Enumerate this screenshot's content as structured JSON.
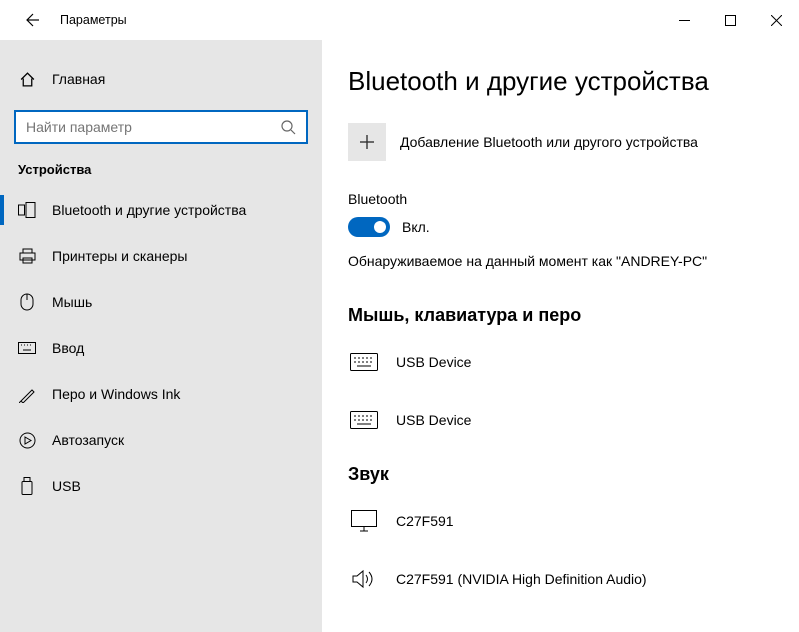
{
  "titlebar": {
    "title": "Параметры"
  },
  "sidebar": {
    "home_label": "Главная",
    "search_placeholder": "Найти параметр",
    "section_title": "Устройства",
    "items": [
      {
        "label": "Bluetooth и другие устройства"
      },
      {
        "label": "Принтеры и сканеры"
      },
      {
        "label": "Мышь"
      },
      {
        "label": "Ввод"
      },
      {
        "label": "Перо и Windows Ink"
      },
      {
        "label": "Автозапуск"
      },
      {
        "label": "USB"
      }
    ]
  },
  "main": {
    "title": "Bluetooth и другие устройства",
    "add_label": "Добавление Bluetooth или другого устройства",
    "bt_label": "Bluetooth",
    "bt_toggle_state": "Вкл.",
    "discover_text": "Обнаруживаемое на данный момент как \"ANDREY-PC\"",
    "group1_title": "Мышь, клавиатура и перо",
    "group1_items": [
      {
        "label": "USB Device"
      },
      {
        "label": "USB Device"
      }
    ],
    "group2_title": "Звук",
    "group2_items": [
      {
        "label": "C27F591"
      },
      {
        "label": "C27F591 (NVIDIA High Definition Audio)"
      }
    ]
  }
}
